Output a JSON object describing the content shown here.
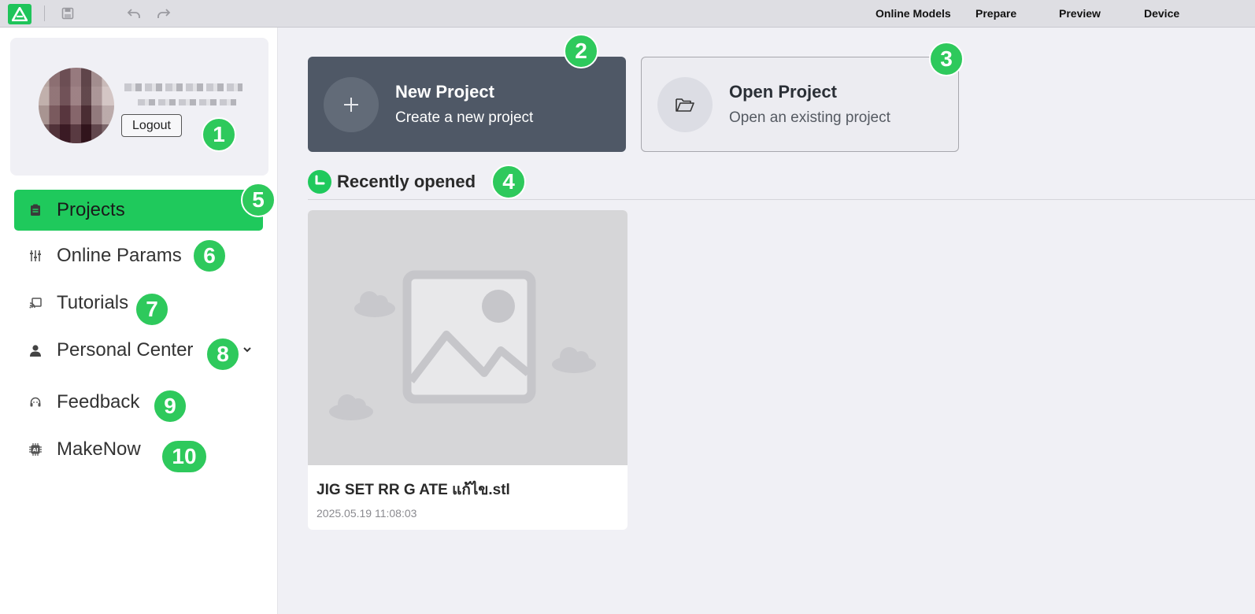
{
  "topbar": {
    "menu": [
      "Online Models",
      "Prepare",
      "Preview",
      "Device"
    ]
  },
  "user": {
    "logout_label": "Logout"
  },
  "sidebar": {
    "items": [
      {
        "label": "Projects",
        "icon": "clipboard-icon",
        "active": true
      },
      {
        "label": "Online Params",
        "icon": "sliders-icon"
      },
      {
        "label": "Tutorials",
        "icon": "cast-icon"
      },
      {
        "label": "Personal Center",
        "icon": "person-icon"
      },
      {
        "label": "Feedback",
        "icon": "headset-icon"
      },
      {
        "label": "MakeNow",
        "icon": "ai-chip-icon"
      }
    ]
  },
  "actions": {
    "new_project": {
      "title": "New Project",
      "subtitle": "Create a new project"
    },
    "open_project": {
      "title": "Open Project",
      "subtitle": "Open an existing project"
    }
  },
  "recent": {
    "title": "Recently opened",
    "projects": [
      {
        "name": "JIG SET RR G ATE แก้ไข.stl",
        "date": "2025.05.19 11:08:03"
      }
    ]
  },
  "badges": [
    "1",
    "2",
    "3",
    "4",
    "5",
    "6",
    "7",
    "8",
    "9",
    "10"
  ],
  "colors": {
    "accent": "#1fc95c",
    "dark_card": "#4f5866",
    "badge": "#2ec95c"
  }
}
